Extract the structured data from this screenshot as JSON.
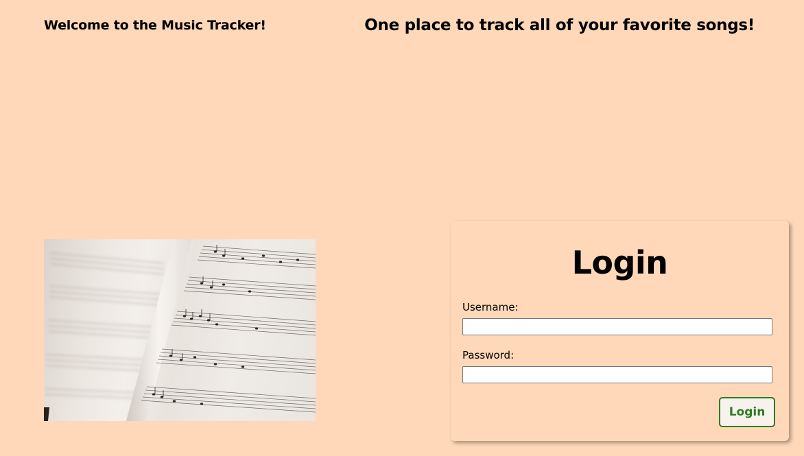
{
  "header": {
    "welcome": "Welcome to the Music Tracker!",
    "tagline": "One place to track all of your favorite songs!"
  },
  "hero": {
    "image_description": "sheet-music-photo"
  },
  "login": {
    "title": "Login",
    "username_label": "Username:",
    "username_value": "",
    "password_label": "Password:",
    "password_value": "",
    "button_label": "Login"
  },
  "colors": {
    "background": "#FED8B8",
    "button_text": "#2E7D1F",
    "button_border": "#2E7D1F"
  }
}
